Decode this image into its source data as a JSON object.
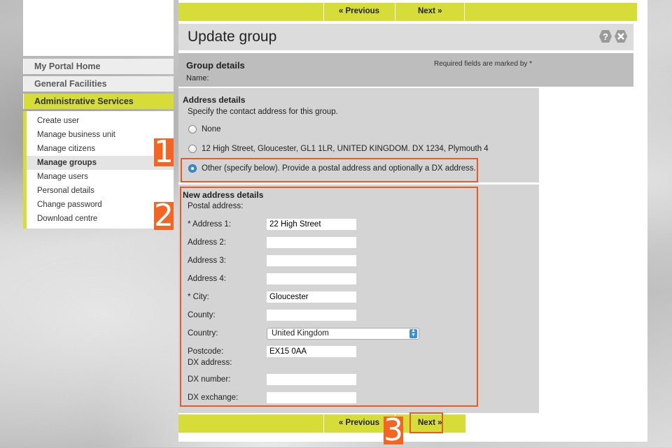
{
  "nav": {
    "previous_label": "« Previous",
    "next_label": "Next »"
  },
  "page": {
    "title": "Update group"
  },
  "sidebar": {
    "sections": [
      "My Portal Home",
      "General Facilities",
      "Administrative Services"
    ],
    "items": [
      {
        "label": "Create user"
      },
      {
        "label": "Manage business unit"
      },
      {
        "label": "Manage citizens"
      },
      {
        "label": "Manage groups",
        "current": true
      },
      {
        "label": "Manage users"
      },
      {
        "label": "Personal details"
      },
      {
        "label": "Change password"
      },
      {
        "label": "Download centre"
      }
    ]
  },
  "group_details": {
    "title": "Group details",
    "name_label": "Name:",
    "required_note": "Required fields are marked by *"
  },
  "address_details": {
    "title": "Address details",
    "subtitle": "Specify the contact address for this group.",
    "options": [
      {
        "label": "None",
        "selected": false
      },
      {
        "label": "12 High Street, Gloucester, GL1 1LR, UNITED KINGDOM. DX 1234, Plymouth 4",
        "selected": false
      },
      {
        "label": "Other (specify below). Provide a postal address and optionally a DX address.",
        "selected": true
      }
    ]
  },
  "new_address": {
    "title": "New address details",
    "postal_label": "Postal address:",
    "address1_label": "* Address 1:",
    "address1_value": "22 High Street",
    "address2_label": "Address 2:",
    "address2_value": "",
    "address3_label": "Address 3:",
    "address3_value": "",
    "address4_label": "Address 4:",
    "address4_value": "",
    "city_label": "* City:",
    "city_value": "Gloucester",
    "county_label": "County:",
    "county_value": "",
    "country_label": "Country:",
    "country_value": "United Kingdom",
    "postcode_label": "Postcode:",
    "postcode_value": "EX15 0AA",
    "dx_address_label": "DX address:",
    "dx_number_label": "DX number:",
    "dx_number_value": "",
    "dx_exchange_label": "DX exchange:",
    "dx_exchange_value": ""
  },
  "callouts": [
    "1",
    "2",
    "3"
  ],
  "colors": {
    "accent": "#d6dc38",
    "callout": "#f26522",
    "radio_selected": "#3b8fd8"
  }
}
